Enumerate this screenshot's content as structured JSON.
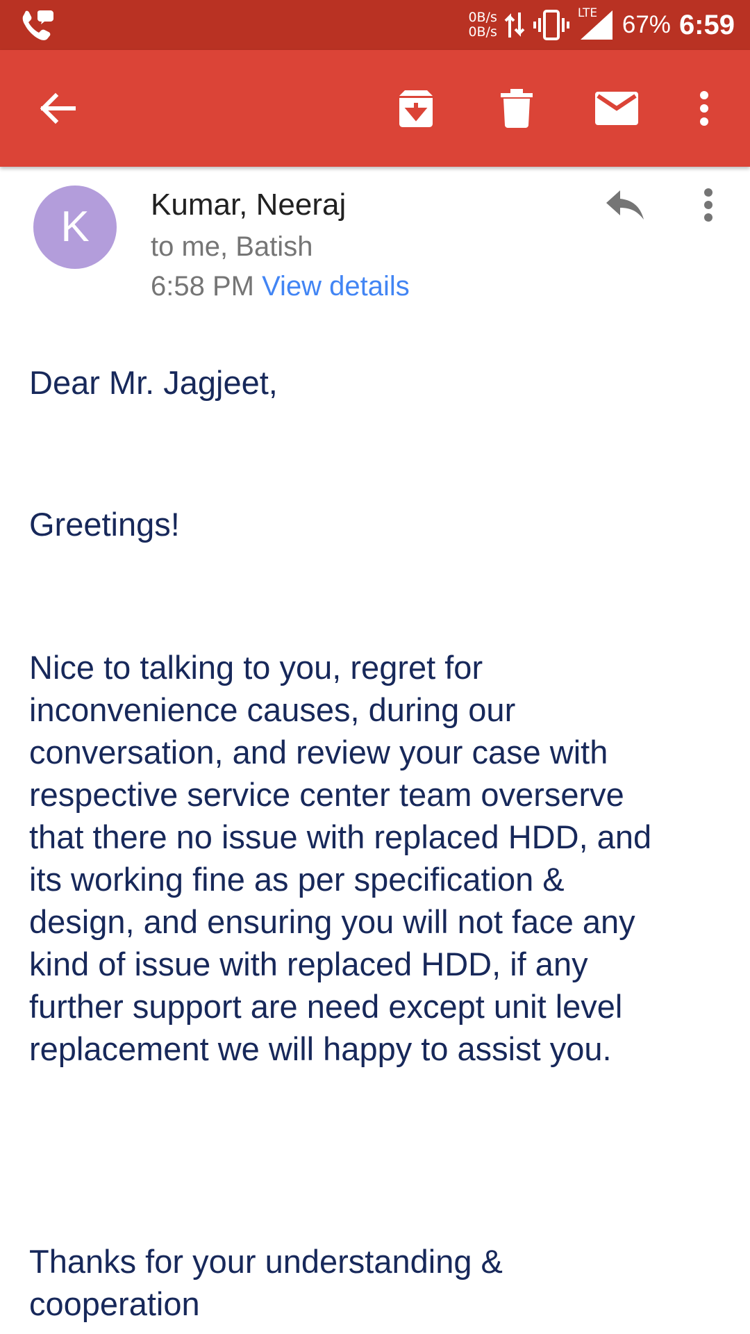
{
  "status_bar": {
    "net_up": "0B/s",
    "net_down": "0B/s",
    "network_type": "LTE",
    "battery": "67%",
    "time": "6:59",
    "icons": [
      "call-icon",
      "data-transfer-icon",
      "vibrate-icon",
      "signal-icon"
    ],
    "color": "#b93223"
  },
  "toolbar": {
    "color": "#db4437",
    "buttons": [
      "back-icon",
      "archive-icon",
      "delete-icon",
      "mark-unread-icon",
      "more-vert-icon"
    ]
  },
  "email": {
    "avatar_letter": "K",
    "avatar_color": "#b39ddb",
    "sender": "Kumar, Neeraj",
    "recipients": "to me, Batish",
    "time": "6:58 PM",
    "view_details": "View details",
    "body": {
      "greeting": "Dear Mr. Jagjeet,",
      "greetings": "Greetings!",
      "main_line_1": "Nice to talking to you, regret for",
      "main_line_2": "inconvenience causes, during our",
      "main_line_3": "conversation, and review your case with",
      "main_line_4": "respective service center team overserve",
      "main_line_5": "that there no issue with replaced HDD, and",
      "main_line_6": "its working fine as per specification &",
      "main_line_7": "design, and ensuring you will not face any",
      "main_line_8": "kind of issue with replaced HDD, if any",
      "main_line_9": "further support are need except unit level",
      "main_line_10": "replacement we will happy to assist you.",
      "closing_line_1": "Thanks for your understanding &",
      "closing_line_2": "cooperation"
    }
  }
}
